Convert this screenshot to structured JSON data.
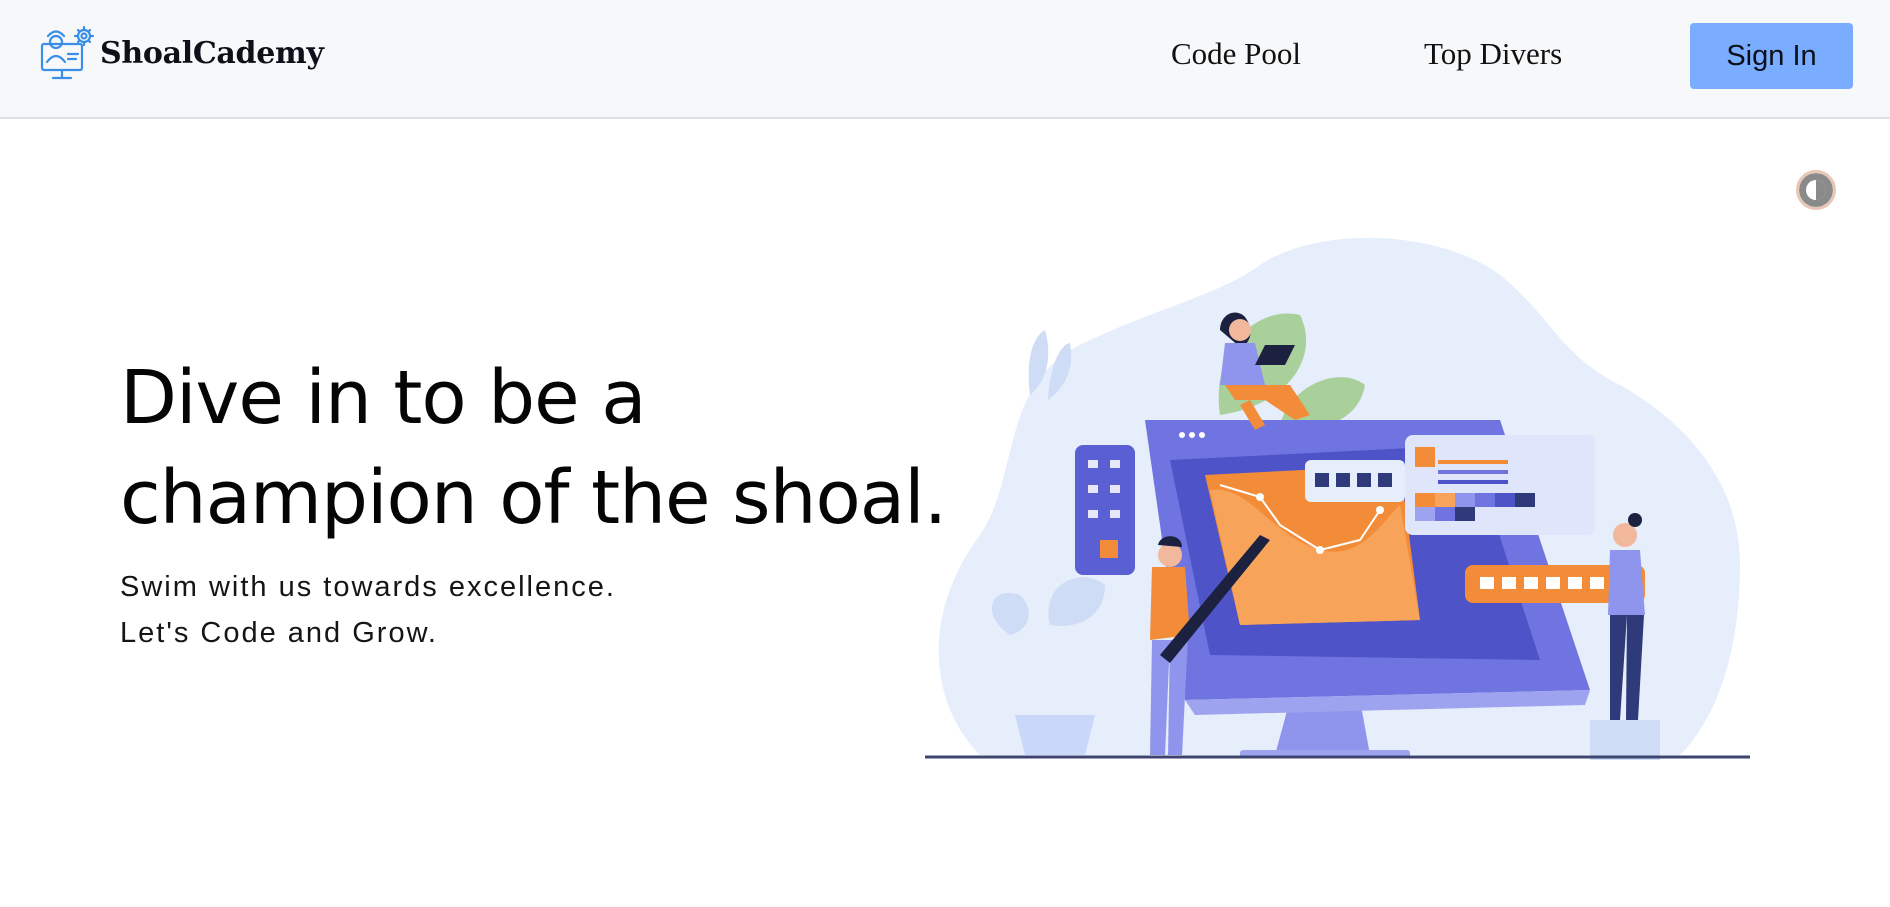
{
  "brand": {
    "name": "ShoalCademy",
    "logo_icon": "developer-gear-icon"
  },
  "nav": {
    "links": [
      {
        "label": "Code Pool"
      },
      {
        "label": "Top Divers"
      }
    ],
    "signin_label": "Sign In"
  },
  "theme_toggle": {
    "icon": "contrast-half-circle-icon"
  },
  "hero": {
    "title_line1": "Dive in to be a",
    "title_line2": "champion of the shoal.",
    "subtitle_line1": "Swim with us towards excellence.",
    "subtitle_line2": "Let's Code and Grow."
  },
  "colors": {
    "accent_button": "#7aadff",
    "navbar_bg": "#f7f8fa",
    "illustration_purple": "#6f74e0",
    "illustration_orange": "#f28c38"
  }
}
